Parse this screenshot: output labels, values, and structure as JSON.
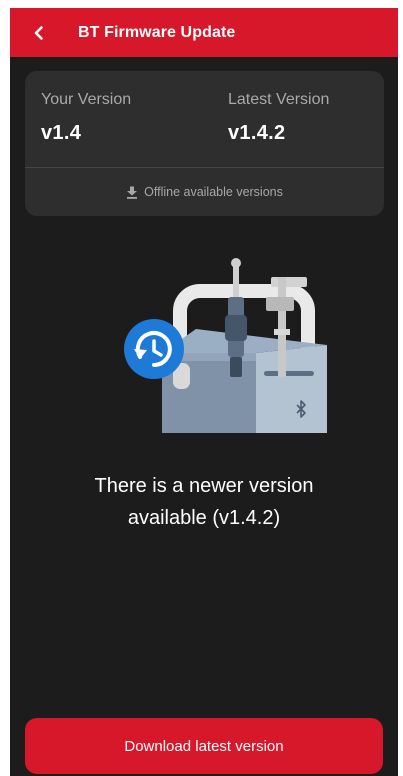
{
  "header": {
    "title": "BT Firmware Update",
    "back_icon": "chevron-left-icon",
    "bg_color": "#d7182a"
  },
  "versions": {
    "current_label": "Your Version",
    "current_value": "v1.4",
    "latest_label": "Latest Version",
    "latest_value": "v1.4.2",
    "offline_label": "Offline available versions",
    "offline_icon": "download-icon"
  },
  "illustration": {
    "icon": "firmware-update-illustration",
    "badge_icon": "update-clock-icon",
    "bluetooth_icon": "bluetooth-icon"
  },
  "message": {
    "line1": "There is a newer version",
    "line2": "available (v1.4.2)"
  },
  "download_button": {
    "label": "Download latest version",
    "color": "#d7182a"
  }
}
